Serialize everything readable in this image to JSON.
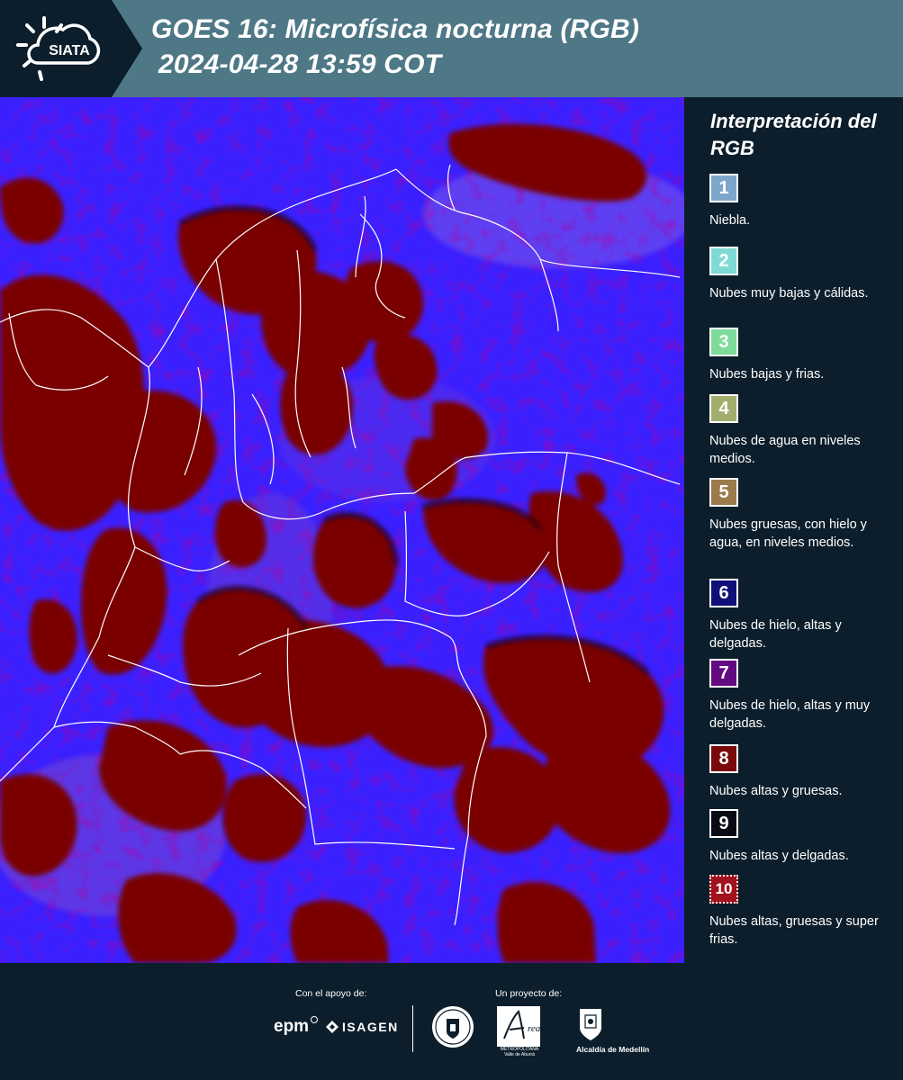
{
  "header": {
    "logo_text": "SIATA",
    "title_line1": "GOES 16: Microfísica nocturna (RGB)",
    "title_line2": "2024-04-28 13:59 COT",
    "background_color": "#4e7886"
  },
  "map": {
    "icon": "satellite-rgb-map",
    "background_color": "#3a20ff",
    "cloud_color": "#7a0404",
    "border_color": "#ffffff"
  },
  "legend": {
    "title": "Interpretación del RGB",
    "items": [
      {
        "number": "1",
        "label": "Niebla.",
        "color": "#7ea6cc"
      },
      {
        "number": "2",
        "label": "Nubes muy bajas y cálidas.",
        "color": "#7fdad6"
      },
      {
        "number": "3",
        "label": "Nubes bajas y frias.",
        "color": "#7ddc9a"
      },
      {
        "number": "4",
        "label": "Nubes de agua en niveles medios.",
        "color": "#a2ae6c"
      },
      {
        "number": "5",
        "label": "Nubes gruesas, con hielo y agua, en niveles medios.",
        "color": "#9b7b4c"
      },
      {
        "number": "6",
        "label": "Nubes de hielo, altas y delgadas.",
        "color": "#10107a"
      },
      {
        "number": "7",
        "label": "Nubes de hielo, altas y muy delgadas.",
        "color": "#640a80"
      },
      {
        "number": "8",
        "label": "Nubes altas y gruesas.",
        "color": "#7a0a0a"
      },
      {
        "number": "9",
        "label": "Nubes altas y delgadas.",
        "color": "#0a0a16"
      },
      {
        "number": "10",
        "label": "Nubes altas, gruesas y super frias.",
        "color": "#a2121c"
      }
    ]
  },
  "footer": {
    "support_caption": "Con el apoyo de:",
    "project_caption": "Un proyecto de:",
    "sponsors": [
      "epm",
      "ISAGEN"
    ],
    "partners": [
      "Área Metropolitana Valle de Aburrá",
      "Alcaldía de Medellín"
    ],
    "amva_text": "METROPOLITANA Valle de Aburrá",
    "alcaldia_text": "Alcaldía de Medellín"
  }
}
